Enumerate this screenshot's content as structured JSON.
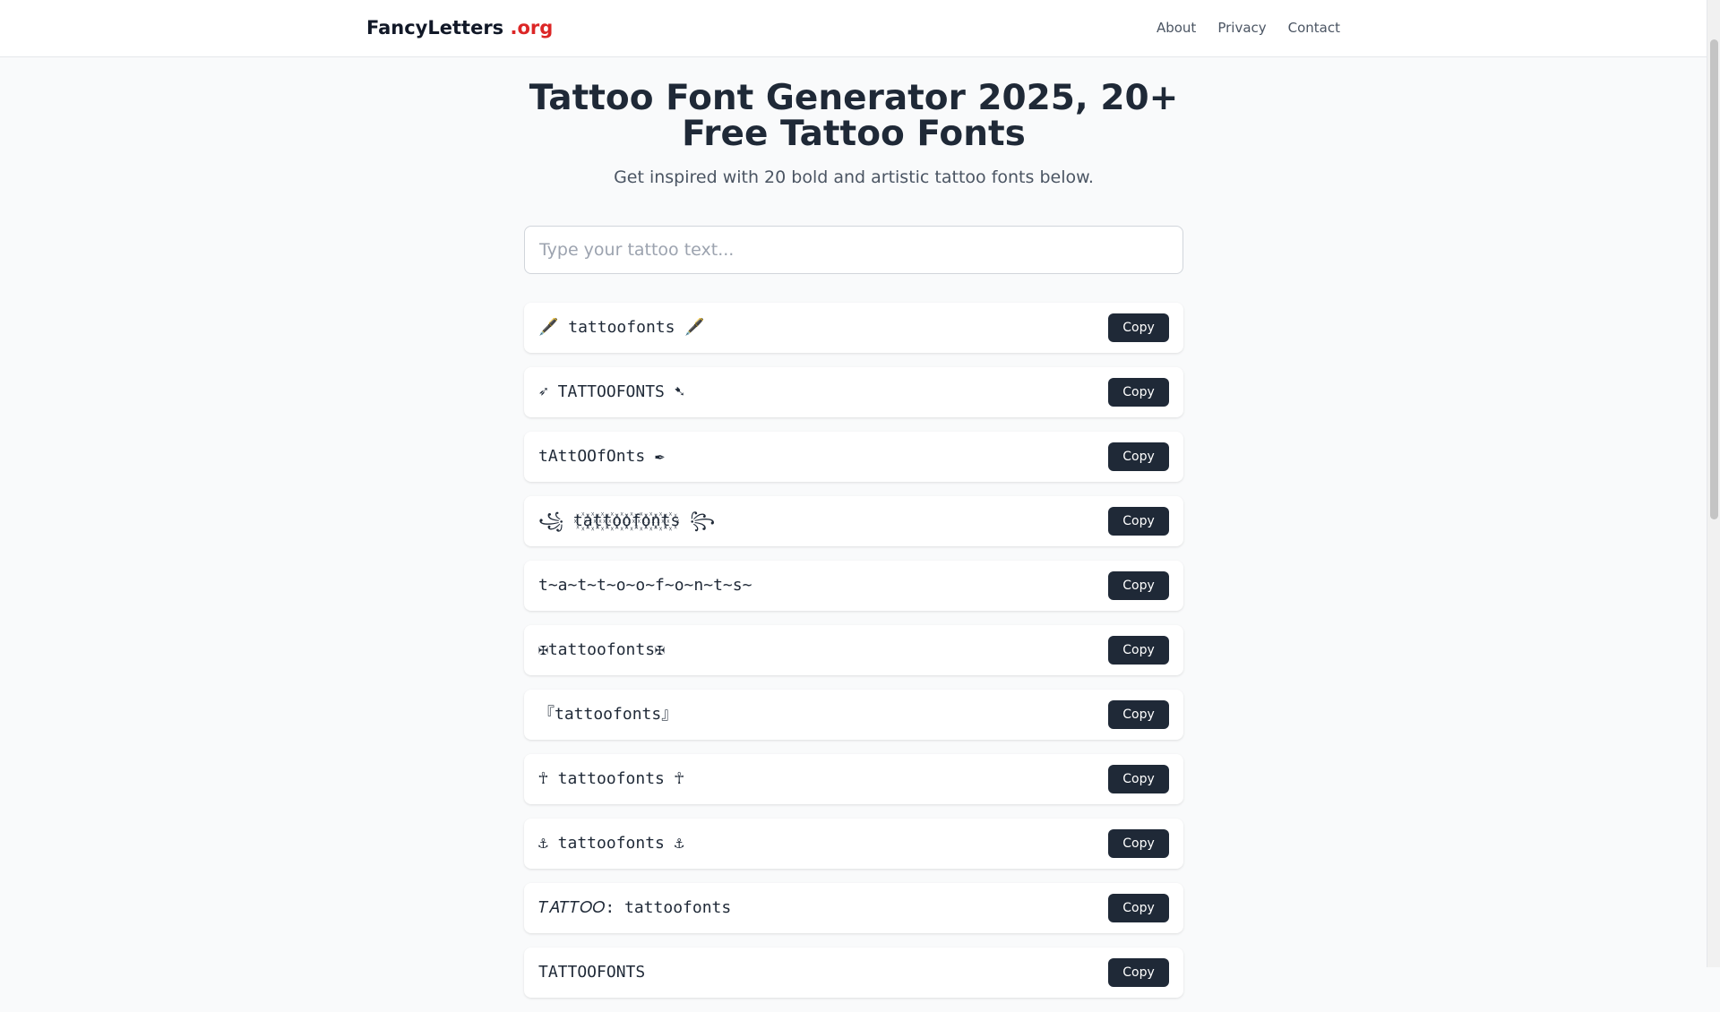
{
  "header": {
    "brand": "FancyLetters",
    "brand_tld": ".org",
    "nav": [
      "About",
      "Privacy",
      "Contact"
    ]
  },
  "hero": {
    "title": "Tattoo Font Generator 2025, 20+ Free Tattoo Fonts",
    "subtitle": "Get inspired with 20 bold and artistic tattoo fonts below."
  },
  "search": {
    "placeholder": "Type your tattoo text...",
    "value": ""
  },
  "fonts": [
    {
      "text": "🖋️ tattoofonts 🖋️",
      "copy_label": "Copy"
    },
    {
      "text": "➶ TATTOOFONTS ➷",
      "copy_label": "Copy"
    },
    {
      "text": "tAttOOfOnts ✒",
      "copy_label": "Copy"
    },
    {
      "text": "꧁ t꙰a꙰t꙰t꙰o꙰o꙰f꙰o꙰n꙰t꙰s ꧂",
      "copy_label": "Copy"
    },
    {
      "text": "t~a~t~t~o~o~f~o~n~t~s~",
      "copy_label": "Copy"
    },
    {
      "text": "✠tattoofonts✠",
      "copy_label": "Copy"
    },
    {
      "text": "『tattoofonts』",
      "copy_label": "Copy"
    },
    {
      "text": "☥ tattoofonts ☥",
      "copy_label": "Copy"
    },
    {
      "text": "⚓ tattoofonts ⚓",
      "copy_label": "Copy"
    },
    {
      "text": "𝑇𝐴𝑇𝑇𝑂𝑂: tattoofonts",
      "copy_label": "Copy"
    },
    {
      "text": "TATTOOFONTS",
      "copy_label": "Copy"
    }
  ],
  "colors": {
    "brand_accent": "#dc2626",
    "button_bg": "#1f2937",
    "page_bg": "#f9fafb"
  }
}
